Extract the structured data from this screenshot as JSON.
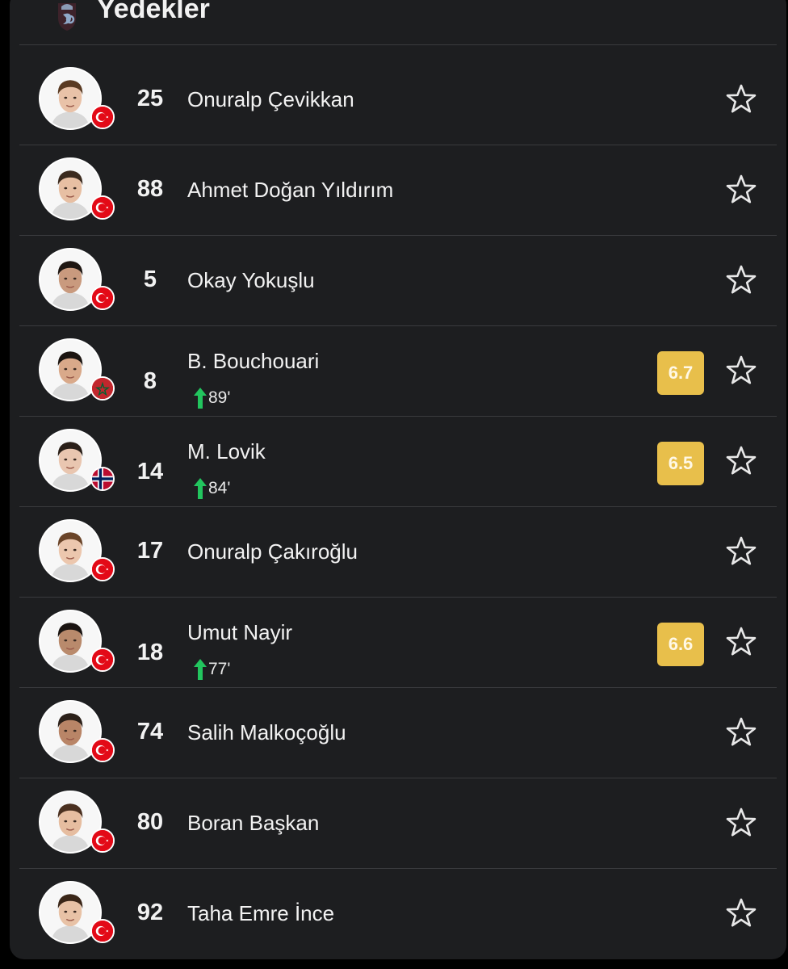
{
  "header": {
    "title": "Yedekler",
    "team_logo_icon": "trabzonspor-crest-icon"
  },
  "colors": {
    "card_bg": "#1d1e20",
    "rating_bg": "#e8bf4b",
    "sub_arrow": "#22c55e",
    "divider": "#3a3b3e"
  },
  "players": [
    {
      "number": "25",
      "name": "Onuralp Çevikkan",
      "flag": "turkey",
      "rating": "",
      "sub_minute": ""
    },
    {
      "number": "88",
      "name": "Ahmet Doğan Yıldırım",
      "flag": "turkey",
      "rating": "",
      "sub_minute": ""
    },
    {
      "number": "5",
      "name": "Okay Yokuşlu",
      "flag": "turkey",
      "rating": "",
      "sub_minute": ""
    },
    {
      "number": "8",
      "name": "B. Bouchouari",
      "flag": "morocco",
      "rating": "6.7",
      "sub_minute": "89'"
    },
    {
      "number": "14",
      "name": "M. Lovik",
      "flag": "norway",
      "rating": "6.5",
      "sub_minute": "84'"
    },
    {
      "number": "17",
      "name": "Onuralp Çakıroğlu",
      "flag": "turkey",
      "rating": "",
      "sub_minute": ""
    },
    {
      "number": "18",
      "name": "Umut Nayir",
      "flag": "turkey",
      "rating": "6.6",
      "sub_minute": "77'"
    },
    {
      "number": "74",
      "name": "Salih Malkoçoğlu",
      "flag": "turkey",
      "rating": "",
      "sub_minute": ""
    },
    {
      "number": "80",
      "name": "Boran Başkan",
      "flag": "turkey",
      "rating": "",
      "sub_minute": ""
    },
    {
      "number": "92",
      "name": "Taha Emre İnce",
      "flag": "turkey",
      "rating": "",
      "sub_minute": ""
    }
  ]
}
